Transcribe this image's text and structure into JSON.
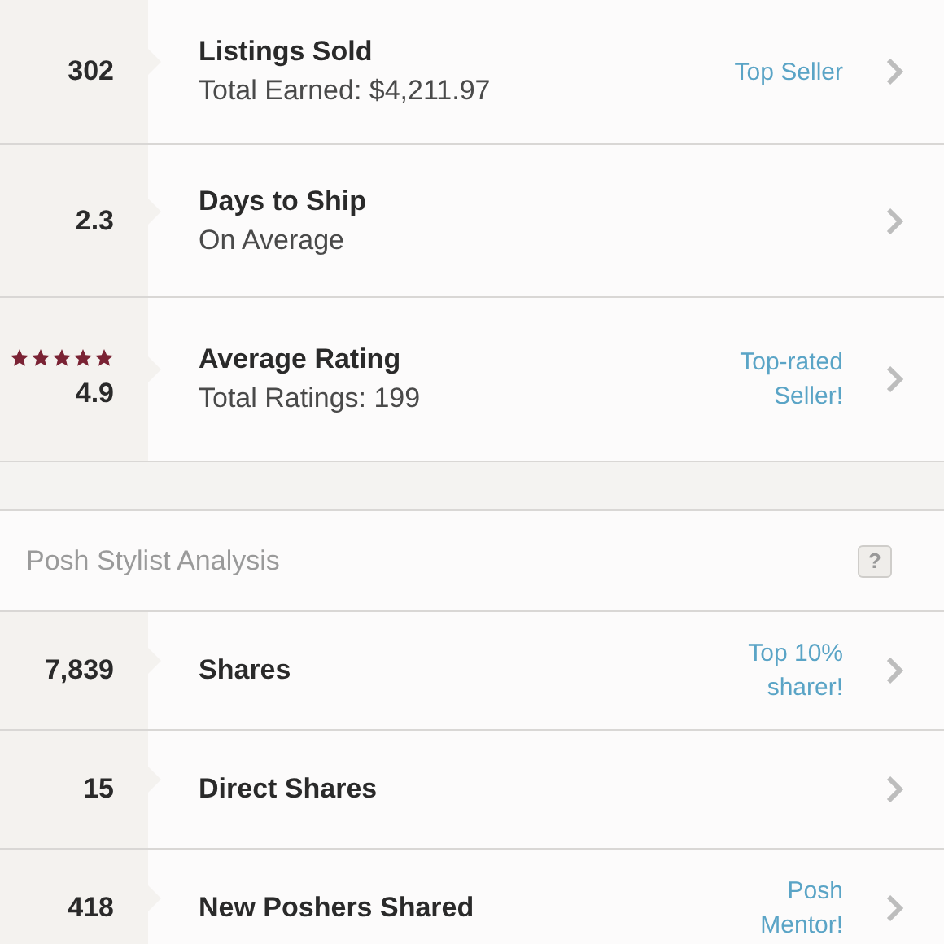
{
  "stats": [
    {
      "value": "302",
      "title": "Listings Sold",
      "subtitle": "Total Earned: $4,211.97",
      "badge": "Top Seller"
    },
    {
      "value": "2.3",
      "title": "Days to Ship",
      "subtitle": "On Average"
    },
    {
      "value": "4.9",
      "stars": 5,
      "title": "Average Rating",
      "subtitle": "Total Ratings: 199",
      "badge": "Top-rated Seller!"
    }
  ],
  "stylist_section": {
    "title": "Posh Stylist Analysis",
    "help": "?",
    "rows": [
      {
        "value": "7,839",
        "title": "Shares",
        "badge": "Top 10% sharer!"
      },
      {
        "value": "15",
        "title": "Direct Shares"
      },
      {
        "value": "418",
        "title": "New Poshers Shared",
        "badge": "Posh Mentor!"
      }
    ]
  }
}
